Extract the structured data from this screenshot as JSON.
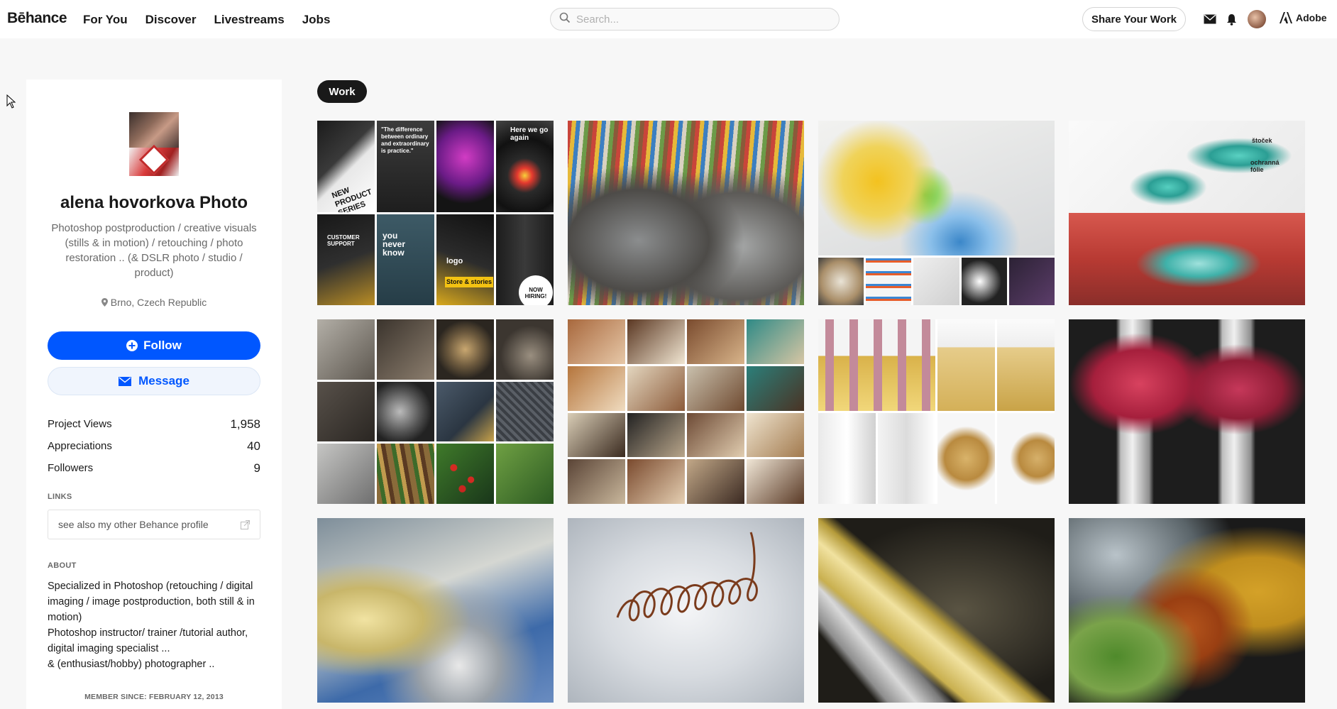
{
  "header": {
    "logo": "Bēhance",
    "nav": [
      "For You",
      "Discover",
      "Livestreams",
      "Jobs"
    ],
    "search_placeholder": "Search...",
    "share_label": "Share Your Work",
    "adobe_label": "Adobe",
    "icons": [
      "mail-icon",
      "bell-icon"
    ]
  },
  "profile": {
    "name": "alena hovorkova Photo",
    "description": "Photoshop postproduction / creative visuals (stills & in motion) / retouching / photo restoration .. (& DSLR photo / studio / product)",
    "location": "Brno, Czech Republic",
    "follow_label": "Follow",
    "message_label": "Message",
    "stats": [
      {
        "label": "Project Views",
        "value": "1,958"
      },
      {
        "label": "Appreciations",
        "value": "40"
      },
      {
        "label": "Followers",
        "value": "9"
      }
    ],
    "links_heading": "LINKS",
    "link_text": "see also my other Behance profile",
    "about_heading": "ABOUT",
    "about_lines": [
      "Specialized in Photoshop (retouching / digital imaging / image postproduction, both still & in motion)",
      "Photoshop instructor/ trainer /tutorial author, digital imaging specialist ...",
      "& (enthusiast/hobby) photographer .."
    ],
    "member_since": "MEMBER SINCE: FEBRUARY 12, 2013"
  },
  "main": {
    "active_tab": "Work",
    "project_tile_texts": {
      "new_product": "NEW PRODUCT SERIES",
      "difference": "\"The difference between ordinary and extraordinary is practice.\"",
      "here_we_go": "Here we go again",
      "customer_support": "CUSTOMER SUPPORT",
      "you_never_know": "you never know",
      "logo": "logo",
      "store_stories": "Store & stories",
      "now_hiring": "NOW HIRING!",
      "stocek": "štoček",
      "ochranna": "ochranná fólie"
    }
  },
  "colors": {
    "brand_blue": "#0057ff",
    "dark": "#191919"
  }
}
